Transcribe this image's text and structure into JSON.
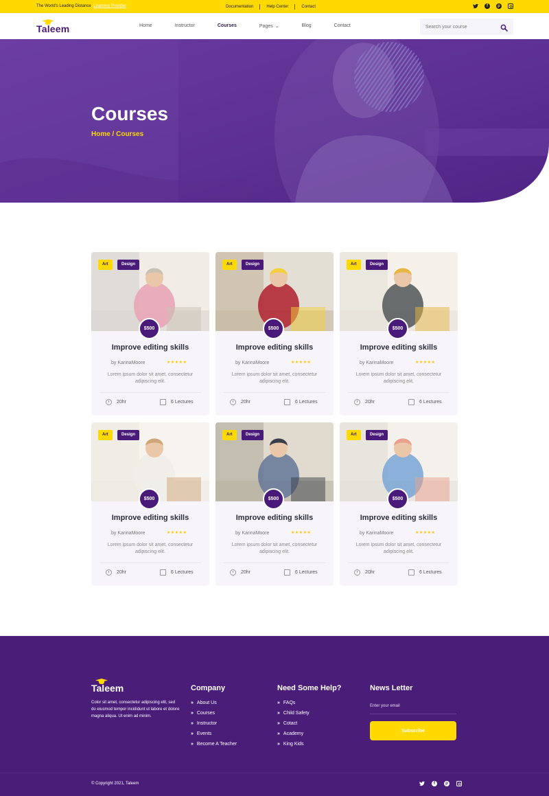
{
  "topbar": {
    "tagline": "The World's Leading Distance",
    "tagline_highlight": "Learning Provider",
    "links": [
      "Documentation",
      "Help Center",
      "Contact"
    ],
    "socials": [
      "twitter-icon",
      "facebook-icon",
      "pinterest-icon",
      "instagram-icon"
    ]
  },
  "brand": {
    "name": "Taleem"
  },
  "nav": {
    "items": [
      "Home",
      "Instructor",
      "Courses",
      "Pages",
      "Blog",
      "Contact"
    ],
    "active": "Courses",
    "search_placeholder": "Search your course"
  },
  "hero": {
    "title": "Courses",
    "breadcrumb": "Home / Courses"
  },
  "courses": [
    {
      "tags": [
        "Art",
        "Design"
      ],
      "price": "$500",
      "title": "Improve editing skills",
      "author": "by KarinaMoore",
      "rating": 5,
      "stars": "★★★★★",
      "description": "Lorem ipsum dolor sit amet, consectetur adipiscing elit.",
      "hours": "20hr",
      "lectures": "6 Lectures"
    },
    {
      "tags": [
        "Art",
        "Design"
      ],
      "price": "$500",
      "title": "Improve editing skills",
      "author": "by KarinaMoore",
      "rating": 5,
      "stars": "★★★★★",
      "description": "Lorem ipsum dolor sit amet, consectetur adipiscing elit.",
      "hours": "20hr",
      "lectures": "6 Lectures"
    },
    {
      "tags": [
        "Art",
        "Design"
      ],
      "price": "$500",
      "title": "Improve editing skills",
      "author": "by KarinaMoore",
      "rating": 5,
      "stars": "★★★★★",
      "description": "Lorem ipsum dolor sit amet, consectetur adipiscing elit.",
      "hours": "20hr",
      "lectures": "6 Lectures"
    },
    {
      "tags": [
        "Art",
        "Design"
      ],
      "price": "$500",
      "title": "Improve editing skills",
      "author": "by KarinaMoore",
      "rating": 5,
      "stars": "★★★★★",
      "description": "Lorem ipsum dolor sit amet, consectetur adipiscing elit.",
      "hours": "20hr",
      "lectures": "6 Lectures"
    },
    {
      "tags": [
        "Art",
        "Design"
      ],
      "price": "$500",
      "title": "Improve editing skills",
      "author": "by KarinaMoore",
      "rating": 5,
      "stars": "★★★★★",
      "description": "Lorem ipsum dolor sit amet, consectetur adipiscing elit.",
      "hours": "20hr",
      "lectures": "6 Lectures"
    },
    {
      "tags": [
        "Art",
        "Design"
      ],
      "price": "$500",
      "title": "Improve editing skills",
      "author": "by KarinaMoore",
      "rating": 5,
      "stars": "★★★★★",
      "description": "Lorem ipsum dolor sit amet, consectetur adipiscing elit.",
      "hours": "20hr",
      "lectures": "6 Lectures"
    }
  ],
  "footer": {
    "about": "Color sit amet, consectetur adipiscing elit, sed do eiusmod tempor incididunt ut labore et dolore magna aliqua. Ut enim ad minim.",
    "company_title": "Company",
    "company_links": [
      "About Us",
      "Courses",
      "Instructor",
      "Events",
      "Become A Teacher"
    ],
    "help_title": "Need Some Help?",
    "help_links": [
      "FAQs",
      "Child Safety",
      "Cotact",
      "Academy",
      "King Kids"
    ],
    "newsletter_title": "News Letter",
    "email_placeholder": "Enter your email",
    "subscribe_label": "Subscribe",
    "copyright": "© Copyright 2021, Taleem",
    "socials": [
      "twitter-icon",
      "facebook-icon",
      "pinterest-icon",
      "instagram-icon"
    ]
  },
  "colors": {
    "accent_yellow": "#ffd900",
    "brand_purple": "#4a1a7a",
    "footer_purple": "#4a1d78",
    "hero_overlay": "#5a2e90"
  }
}
